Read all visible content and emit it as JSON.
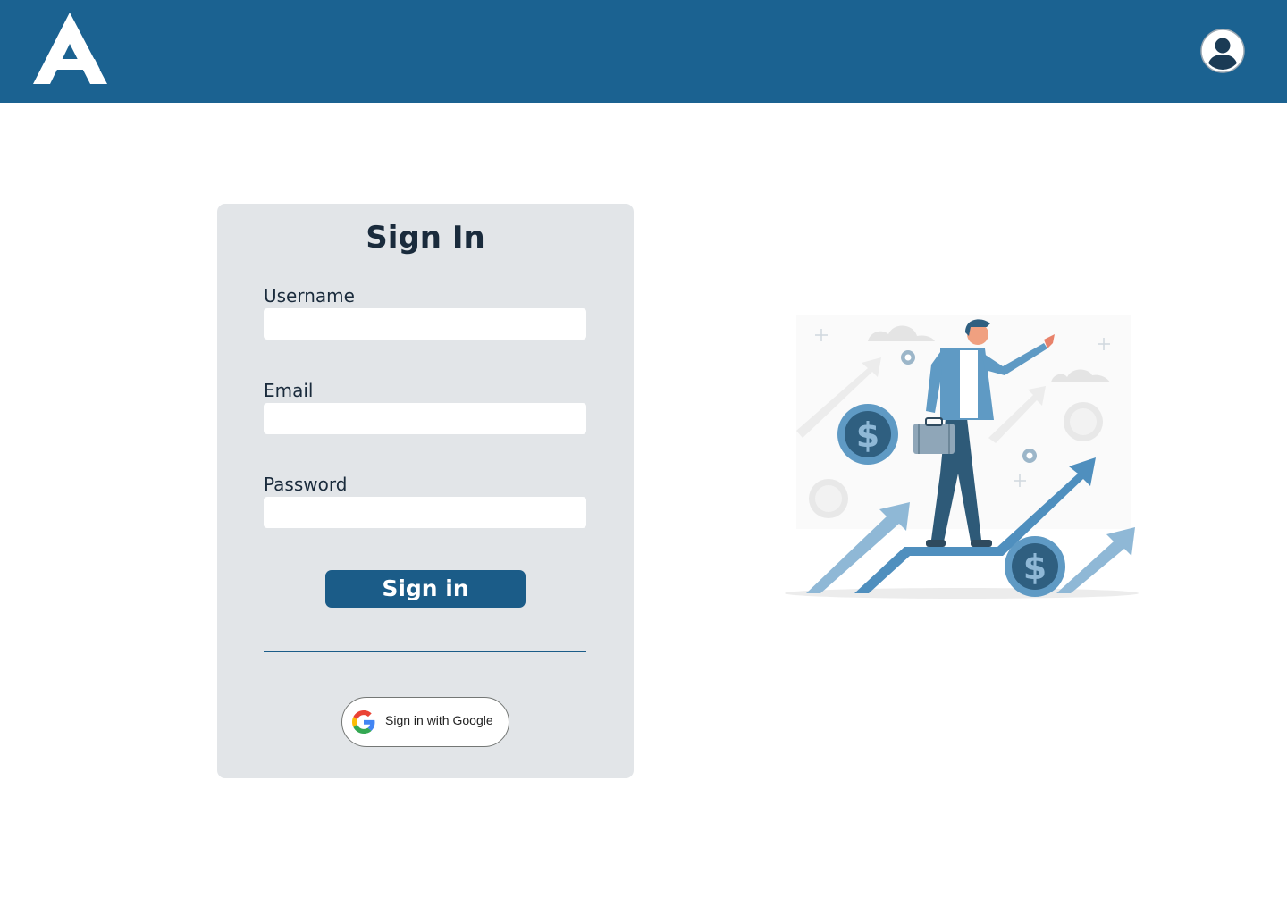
{
  "header": {
    "logo_icon": "app-logo-letter-a",
    "profile_icon": "user-avatar-icon",
    "colors": {
      "background": "#1b6291"
    }
  },
  "signin_card": {
    "title": "Sign In",
    "fields": {
      "username": {
        "label": "Username",
        "value": "",
        "placeholder": ""
      },
      "email": {
        "label": "Email",
        "value": "",
        "placeholder": ""
      },
      "password": {
        "label": "Password",
        "value": "",
        "placeholder": ""
      }
    },
    "submit_label": "Sign in",
    "google_button_label": "Sign in with Google",
    "google_icon": "google-g-icon",
    "colors": {
      "card_background": "#e2e5e8",
      "button": "#1b5c88",
      "text": "#1a2b3c"
    }
  },
  "illustration": {
    "icon": "business-growth-illustration",
    "colors": {
      "primary": "#5b9bc4",
      "dark": "#2e5a78",
      "light": "#d8d8d8"
    }
  }
}
